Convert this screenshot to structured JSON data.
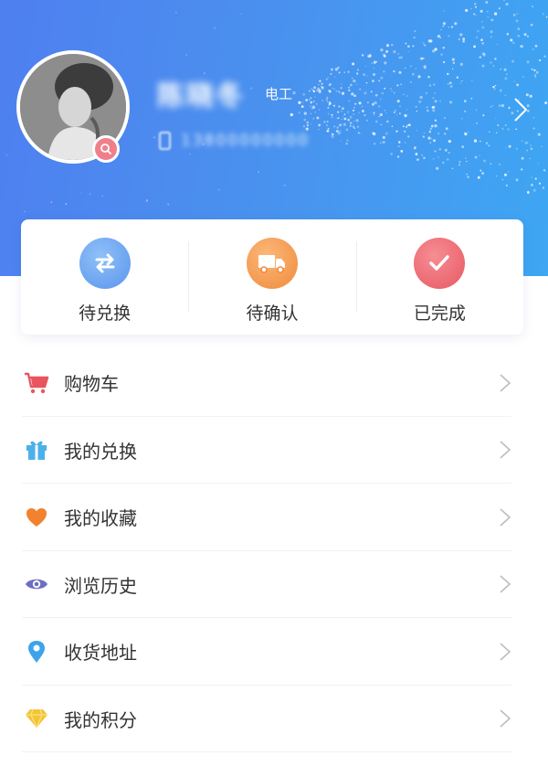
{
  "profile": {
    "name": "陈晓冬",
    "role": "电工",
    "phone": "13800000000"
  },
  "orders": [
    {
      "label": "待兑换",
      "icon": "exchange-arrows-icon",
      "color": "#6aa3f0"
    },
    {
      "label": "待确认",
      "icon": "delivery-truck-icon",
      "color": "#f59a4e"
    },
    {
      "label": "已完成",
      "icon": "checkmark-icon",
      "color": "#ee6b74"
    }
  ],
  "menu": [
    {
      "label": "购物车",
      "icon": "cart-icon",
      "color": "#e9545f"
    },
    {
      "label": "我的兑换",
      "icon": "gift-icon",
      "color": "#4ab1ea"
    },
    {
      "label": "我的收藏",
      "icon": "heart-icon",
      "color": "#f2822e"
    },
    {
      "label": "浏览历史",
      "icon": "eye-icon",
      "color": "#6b6fc0"
    },
    {
      "label": "收货地址",
      "icon": "location-pin-icon",
      "color": "#3da4ea"
    },
    {
      "label": "我的积分",
      "icon": "diamond-icon",
      "color": "#f3c533"
    }
  ],
  "colors": {
    "header_start": "#4f7ff0",
    "header_end": "#3ea6f3",
    "text": "#333333",
    "chevron": "#bdbdbd"
  }
}
